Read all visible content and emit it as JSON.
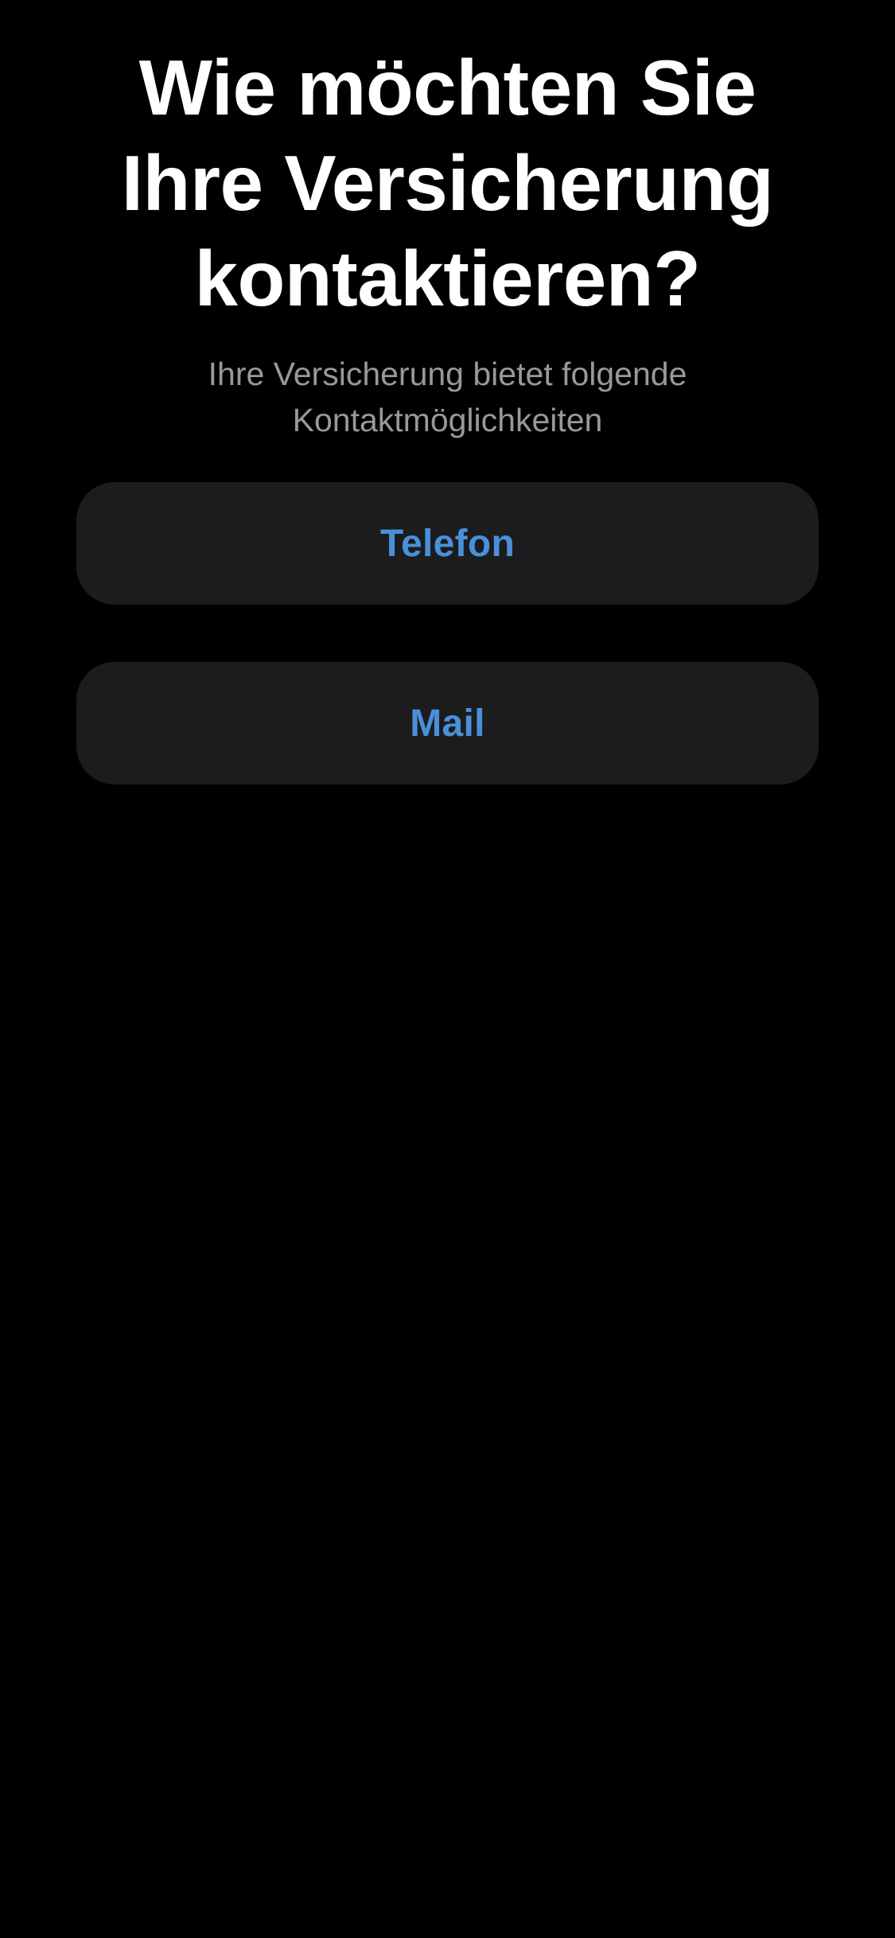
{
  "header": {
    "title_lines": [
      "Wie möchten Sie",
      "Ihre Versicherung",
      "kontaktieren?"
    ],
    "subtitle_lines": [
      "Ihre Versicherung bietet folgende",
      "Kontaktmöglichkeiten"
    ]
  },
  "options": [
    {
      "label": "Telefon"
    },
    {
      "label": "Mail"
    }
  ],
  "colors": {
    "background": "#000000",
    "title": "#ffffff",
    "subtitle": "#98989e",
    "button_background": "#1c1c1e",
    "accent": "#4a90d9"
  }
}
